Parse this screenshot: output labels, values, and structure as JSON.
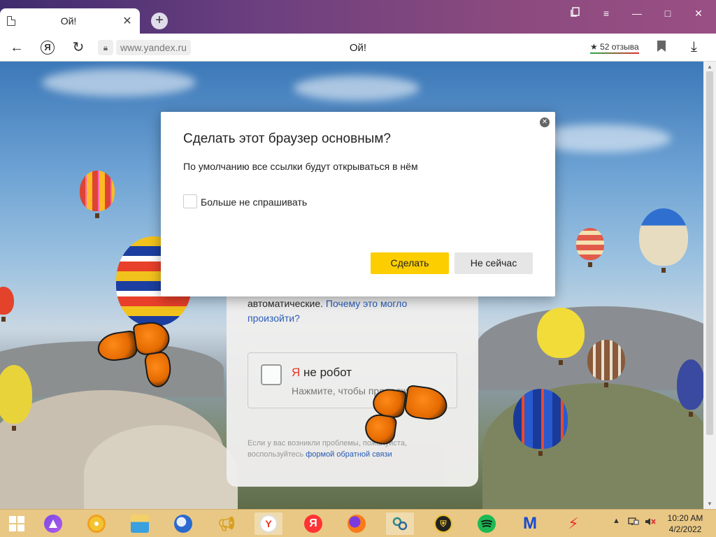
{
  "browser": {
    "tab_title": "Ой!",
    "new_tab_symbol": "+",
    "url": "www.yandex.ru",
    "page_title": "Ой!",
    "reviews_label": "★ 52 отзыва",
    "window_controls": [
      "▢",
      "≡",
      "—",
      "□",
      "✕"
    ]
  },
  "dialog": {
    "title": "Сделать этот браузер основным?",
    "description": "По умолчанию все ссылки будут открываться в нём",
    "checkbox_label": "Больше не спрашивать",
    "primary_button": "Сделать",
    "secondary_button": "Не сейчас"
  },
  "captcha": {
    "text_prefix": "автоматические. ",
    "text_link": "Почему это могло произойти?",
    "robot_ya": "Я",
    "robot_title": " не робот",
    "robot_subtitle": "Нажмите, чтобы продолжить",
    "footer_prefix": "Если у вас возникли проблемы, пожалуйста, воспользуйтесь ",
    "footer_link": "формой обратной связи"
  },
  "taskbar": {
    "apps": [
      {
        "name": "windows-start",
        "icon": "windows-logo-icon"
      },
      {
        "name": "alice",
        "icon": "alice-icon"
      },
      {
        "name": "chrome",
        "icon": "chrome-icon"
      },
      {
        "name": "file-explorer",
        "icon": "folder-icon"
      },
      {
        "name": "thunderbird",
        "icon": "thunderbird-icon"
      },
      {
        "name": "megaphone",
        "icon": "megaphone-icon"
      },
      {
        "name": "yandex-browser",
        "icon": "yandex-browser-icon",
        "active": true
      },
      {
        "name": "yandex",
        "icon": "yandex-icon",
        "label": "Я"
      },
      {
        "name": "firefox",
        "icon": "firefox-icon"
      },
      {
        "name": "link-tool",
        "icon": "chain-link-icon"
      },
      {
        "name": "security",
        "icon": "shield-icon"
      },
      {
        "name": "spotify",
        "icon": "spotify-icon"
      },
      {
        "name": "malwarebytes",
        "icon": "malwarebytes-icon",
        "label": "M"
      },
      {
        "name": "flash-tool",
        "icon": "lightning-icon"
      }
    ],
    "tray_up": "▲",
    "clock_time": "10:20 AM",
    "clock_date": "4/2/2022"
  },
  "colors": {
    "accent_button": "#fcce00",
    "link": "#2358b8",
    "taskbar": "#e9c885"
  }
}
